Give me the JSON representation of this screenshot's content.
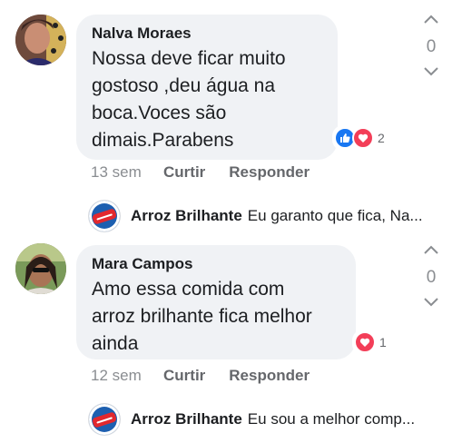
{
  "comments": [
    {
      "author": "Nalva Moraes",
      "lines": [
        "Nossa deve ficar muito",
        "gostoso ,deu água na",
        "boca.Voces são",
        "dimais.Parabens"
      ],
      "reaction_count": "2",
      "votes": "0",
      "time": "13 sem",
      "like_label": "Curtir",
      "reply_label": "Responder",
      "reply": {
        "author": "Arroz Brilhante",
        "text": "Eu garanto que fica, Na..."
      }
    },
    {
      "author": "Mara Campos",
      "lines": [
        "Amo essa comida com",
        "arroz brilhante fica melhor",
        "ainda"
      ],
      "reaction_count": "1",
      "votes": "0",
      "time": "12 sem",
      "like_label": "Curtir",
      "reply_label": "Responder",
      "reply": {
        "author": "Arroz Brilhante",
        "text": "Eu sou a melhor comp..."
      }
    }
  ],
  "colors": {
    "bubble": "#f0f2f5",
    "like": "#1877f2",
    "love": "#f33e58",
    "meta": "#65676b"
  }
}
